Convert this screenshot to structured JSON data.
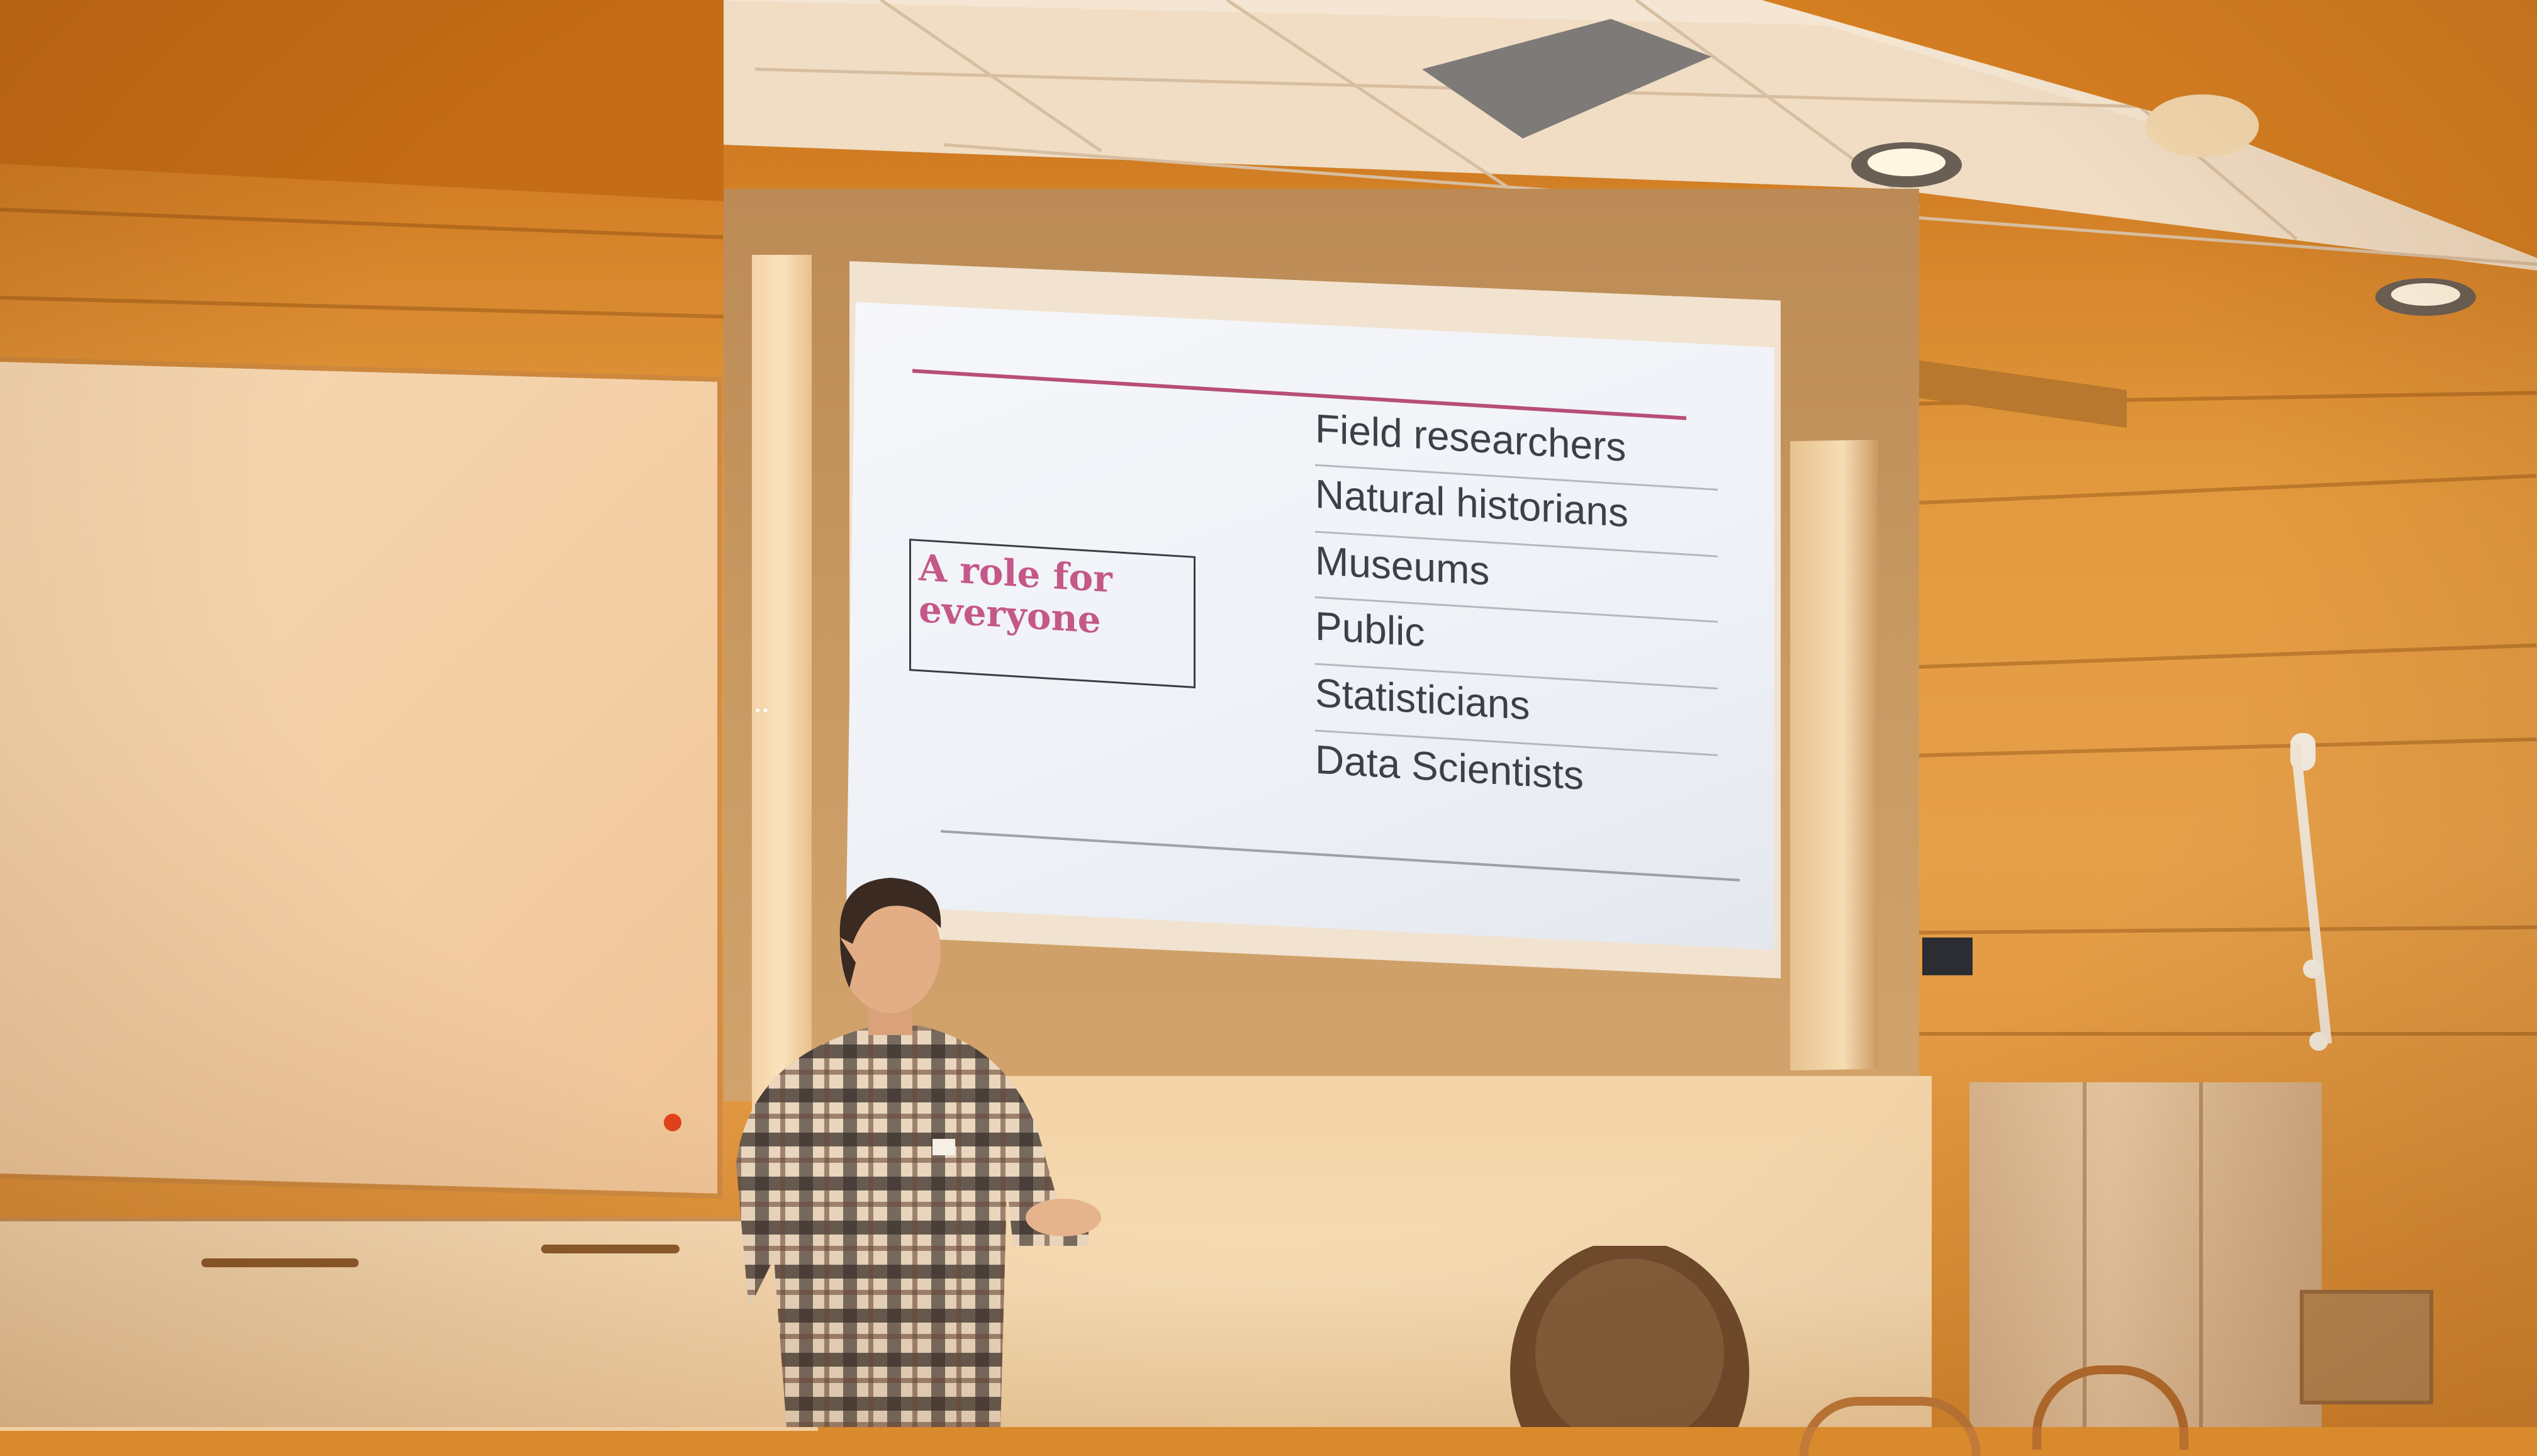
{
  "slide": {
    "box_title": "A role for everyone",
    "roles": [
      "Field researchers",
      "Natural historians",
      "Museums",
      "Public",
      "Statisticians",
      "Data Scientists"
    ],
    "colors": {
      "accent": "#c45888",
      "rule": "#b84e78",
      "text": "#3c4048",
      "background": "#f1f3f7"
    }
  },
  "scene": {
    "walls": "#e39a3e",
    "whiteboard": "#f4d3a9",
    "speaker_shirt": "plaid"
  }
}
